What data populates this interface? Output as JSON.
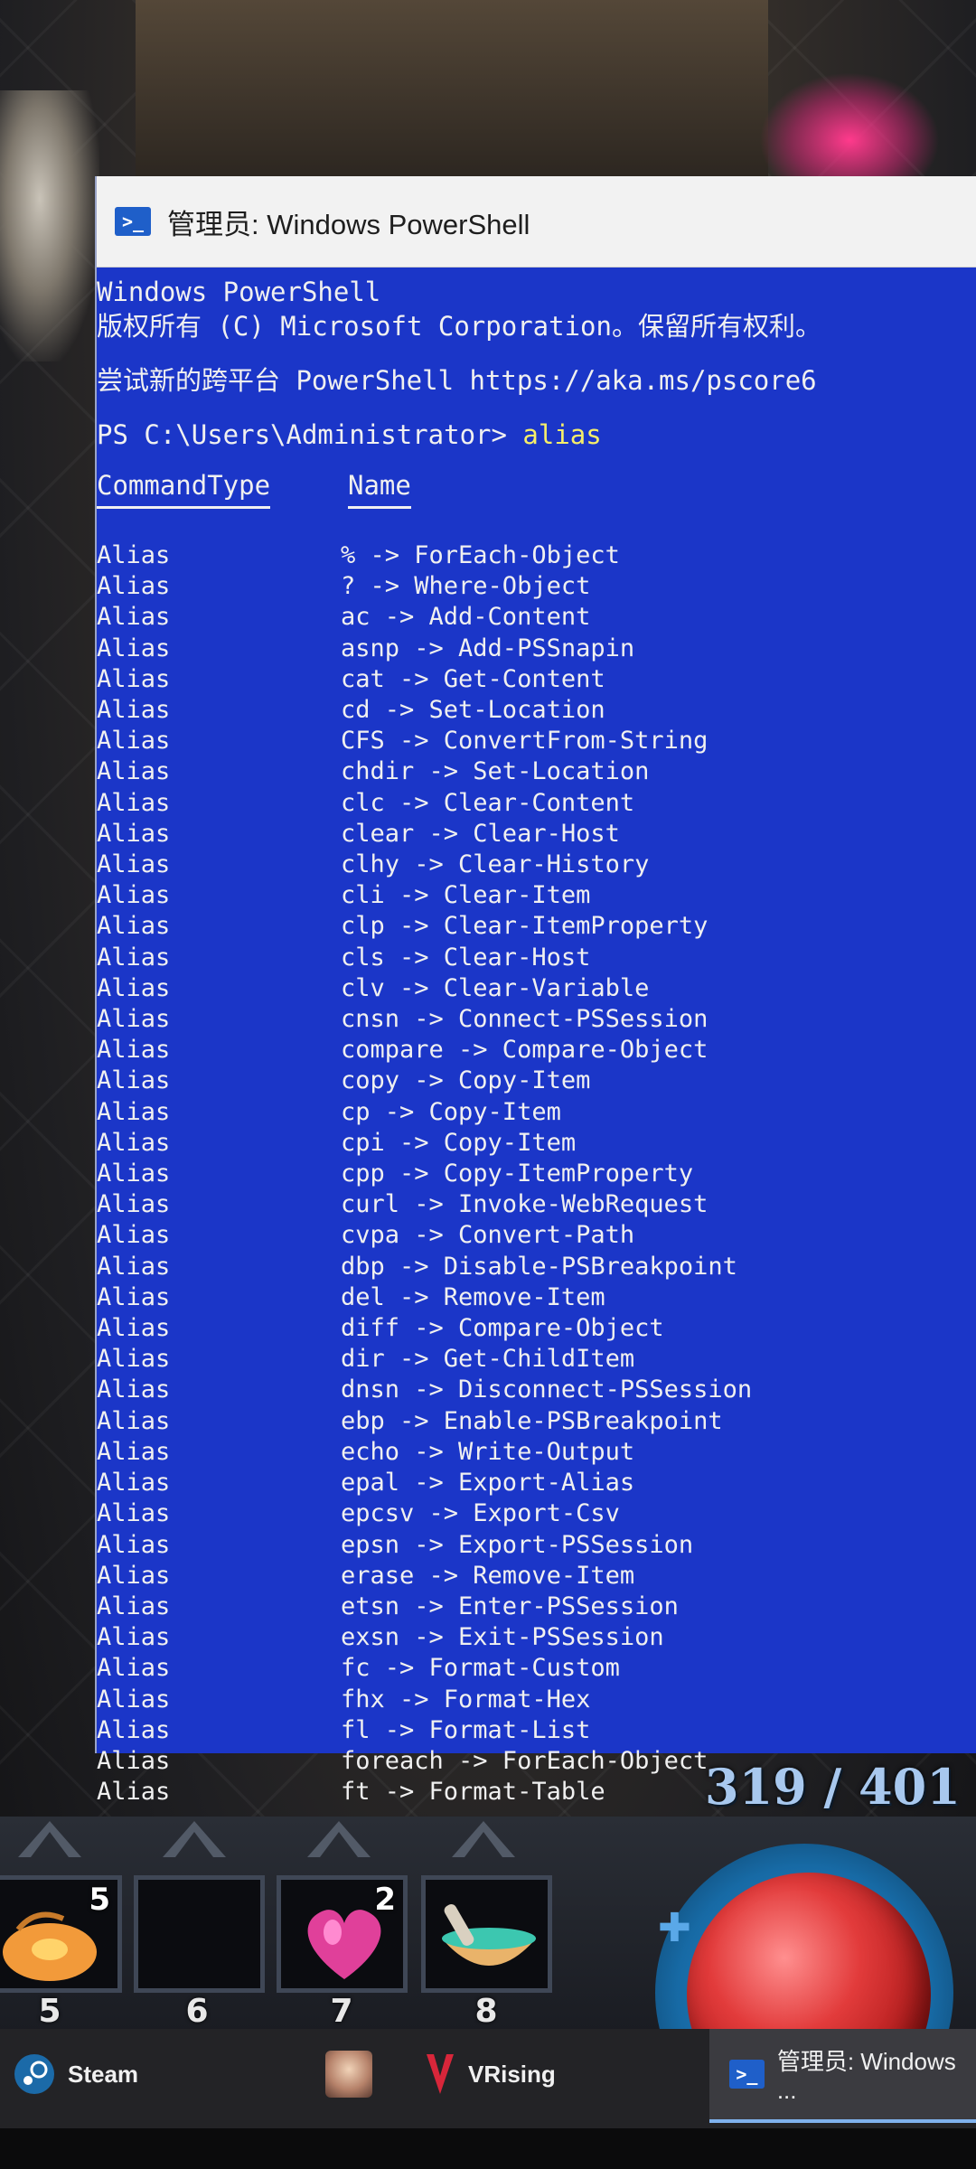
{
  "window": {
    "title": "管理员: Windows PowerShell",
    "icon": "powershell-icon"
  },
  "console": {
    "banner_1": "Windows PowerShell",
    "banner_2": "版权所有 (C) Microsoft Corporation。保留所有权利。",
    "banner_3": "尝试新的跨平台 PowerShell https://aka.ms/pscore6",
    "prompt": "PS C:\\Users\\Administrator> ",
    "command": "alias",
    "header_type": "CommandType",
    "header_name": "Name",
    "rows": [
      {
        "type": "Alias",
        "name": "% -> ForEach-Object"
      },
      {
        "type": "Alias",
        "name": "? -> Where-Object"
      },
      {
        "type": "Alias",
        "name": "ac -> Add-Content"
      },
      {
        "type": "Alias",
        "name": "asnp -> Add-PSSnapin"
      },
      {
        "type": "Alias",
        "name": "cat -> Get-Content"
      },
      {
        "type": "Alias",
        "name": "cd -> Set-Location"
      },
      {
        "type": "Alias",
        "name": "CFS -> ConvertFrom-String"
      },
      {
        "type": "Alias",
        "name": "chdir -> Set-Location"
      },
      {
        "type": "Alias",
        "name": "clc -> Clear-Content"
      },
      {
        "type": "Alias",
        "name": "clear -> Clear-Host"
      },
      {
        "type": "Alias",
        "name": "clhy -> Clear-History"
      },
      {
        "type": "Alias",
        "name": "cli -> Clear-Item"
      },
      {
        "type": "Alias",
        "name": "clp -> Clear-ItemProperty"
      },
      {
        "type": "Alias",
        "name": "cls -> Clear-Host"
      },
      {
        "type": "Alias",
        "name": "clv -> Clear-Variable"
      },
      {
        "type": "Alias",
        "name": "cnsn -> Connect-PSSession"
      },
      {
        "type": "Alias",
        "name": "compare -> Compare-Object"
      },
      {
        "type": "Alias",
        "name": "copy -> Copy-Item"
      },
      {
        "type": "Alias",
        "name": "cp -> Copy-Item"
      },
      {
        "type": "Alias",
        "name": "cpi -> Copy-Item"
      },
      {
        "type": "Alias",
        "name": "cpp -> Copy-ItemProperty"
      },
      {
        "type": "Alias",
        "name": "curl -> Invoke-WebRequest"
      },
      {
        "type": "Alias",
        "name": "cvpa -> Convert-Path"
      },
      {
        "type": "Alias",
        "name": "dbp -> Disable-PSBreakpoint"
      },
      {
        "type": "Alias",
        "name": "del -> Remove-Item"
      },
      {
        "type": "Alias",
        "name": "diff -> Compare-Object"
      },
      {
        "type": "Alias",
        "name": "dir -> Get-ChildItem"
      },
      {
        "type": "Alias",
        "name": "dnsn -> Disconnect-PSSession"
      },
      {
        "type": "Alias",
        "name": "ebp -> Enable-PSBreakpoint"
      },
      {
        "type": "Alias",
        "name": "echo -> Write-Output"
      },
      {
        "type": "Alias",
        "name": "epal -> Export-Alias"
      },
      {
        "type": "Alias",
        "name": "epcsv -> Export-Csv"
      },
      {
        "type": "Alias",
        "name": "epsn -> Export-PSSession"
      },
      {
        "type": "Alias",
        "name": "erase -> Remove-Item"
      },
      {
        "type": "Alias",
        "name": "etsn -> Enter-PSSession"
      },
      {
        "type": "Alias",
        "name": "exsn -> Exit-PSSession"
      },
      {
        "type": "Alias",
        "name": "fc -> Format-Custom"
      },
      {
        "type": "Alias",
        "name": "fhx -> Format-Hex"
      },
      {
        "type": "Alias",
        "name": "fl -> Format-List"
      },
      {
        "type": "Alias",
        "name": "foreach -> ForEach-Object"
      },
      {
        "type": "Alias",
        "name": "ft -> Format-Table"
      }
    ]
  },
  "game_hud": {
    "health": "319 / 401",
    "slots": [
      {
        "key": "5",
        "count": "5",
        "icon": "potion-pouch-icon"
      },
      {
        "key": "6",
        "count": "",
        "icon": ""
      },
      {
        "key": "7",
        "count": "2",
        "icon": "heart-icon"
      },
      {
        "key": "8",
        "count": "",
        "icon": "mortar-bowl-icon"
      }
    ]
  },
  "taskbar": {
    "apps": [
      {
        "label": "Steam",
        "icon": "steam-icon"
      },
      {
        "label": "",
        "icon": "user-avatar-icon"
      },
      {
        "label": "VRising",
        "icon": "vrising-icon"
      },
      {
        "label": "管理员: Windows ...",
        "icon": "powershell-icon"
      }
    ]
  },
  "colors": {
    "console_bg": "#1b36c8",
    "console_fg": "#f0f0f0",
    "command_fg": "#f6ee6a"
  }
}
